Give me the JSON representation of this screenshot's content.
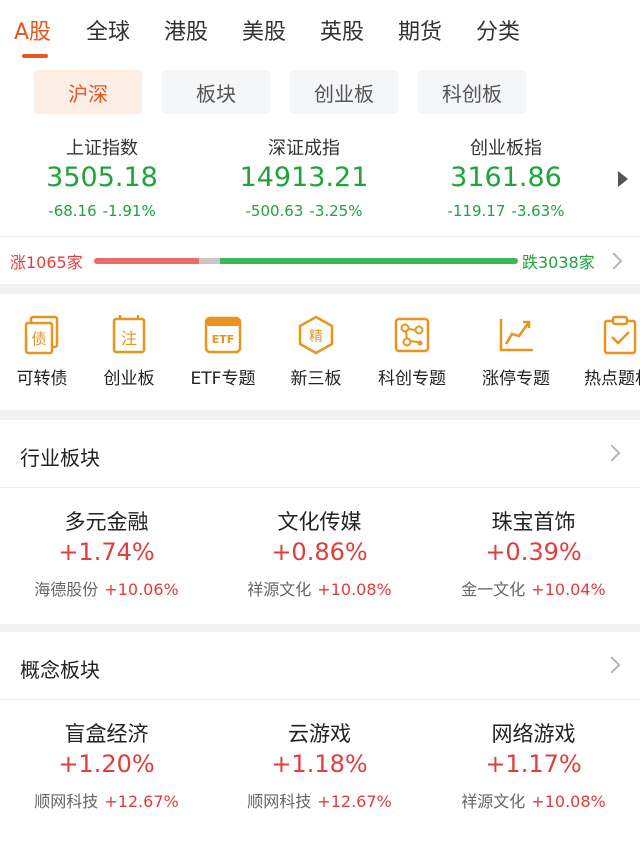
{
  "top_tabs": [
    "A股",
    "全球",
    "港股",
    "美股",
    "英股",
    "期货",
    "分类"
  ],
  "sub_tabs": [
    "沪深",
    "板块",
    "创业板",
    "科创板"
  ],
  "indices": [
    {
      "name": "上证指数",
      "value": "3505.18",
      "change": "-68.16",
      "pct": "-1.91%"
    },
    {
      "name": "深证成指",
      "value": "14913.21",
      "change": "-500.63",
      "pct": "-3.25%"
    },
    {
      "name": "创业板指",
      "value": "3161.86",
      "change": "-119.17",
      "pct": "-3.63%"
    }
  ],
  "breadth": {
    "up_label": "涨1065家",
    "down_label": "跌3038家",
    "up_count": 1065,
    "down_count": 3038,
    "flat_share": 0.05
  },
  "shortcuts": [
    {
      "label": "可转债",
      "icon": "bond-icon"
    },
    {
      "label": "创业板",
      "icon": "note-icon"
    },
    {
      "label": "ETF专题",
      "icon": "etf-icon"
    },
    {
      "label": "新三板",
      "icon": "jing-icon"
    },
    {
      "label": "科创专题",
      "icon": "network-icon"
    },
    {
      "label": "涨停专题",
      "icon": "rising-chart-icon"
    },
    {
      "label": "热点题材",
      "icon": "clipboard-check-icon"
    }
  ],
  "industry": {
    "title": "行业板块",
    "items": [
      {
        "name": "多元金融",
        "pct": "+1.74%",
        "leader": "海德股份",
        "leader_pct": "+10.06%"
      },
      {
        "name": "文化传媒",
        "pct": "+0.86%",
        "leader": "祥源文化",
        "leader_pct": "+10.08%"
      },
      {
        "name": "珠宝首饰",
        "pct": "+0.39%",
        "leader": "金一文化",
        "leader_pct": "+10.04%"
      }
    ]
  },
  "concept": {
    "title": "概念板块",
    "items": [
      {
        "name": "盲盒经济",
        "pct": "+1.20%",
        "leader": "顺网科技",
        "leader_pct": "+12.67%"
      },
      {
        "name": "云游戏",
        "pct": "+1.18%",
        "leader": "顺网科技",
        "leader_pct": "+12.67%"
      },
      {
        "name": "网络游戏",
        "pct": "+1.17%",
        "leader": "祥源文化",
        "leader_pct": "+10.08%"
      }
    ]
  },
  "colors": {
    "accent": "#e8551e",
    "up": "#e23c3c",
    "down": "#1fa33a",
    "icon": "#e8941e"
  }
}
